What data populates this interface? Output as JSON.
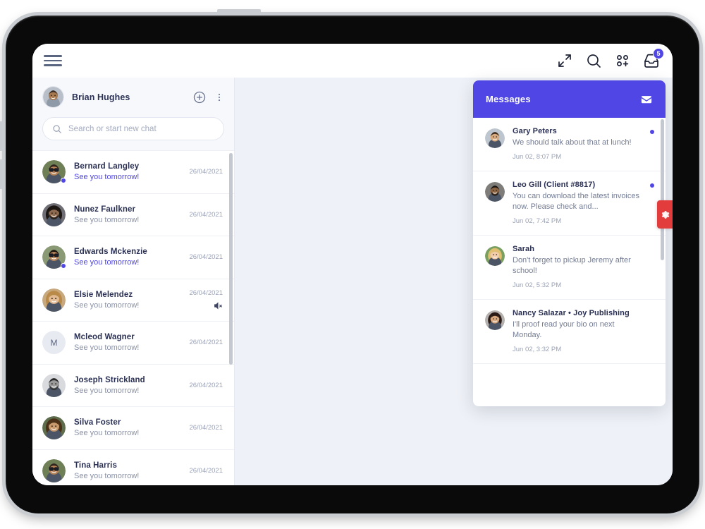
{
  "topbar": {
    "menu_icon": "hamburger-icon",
    "actions": [
      {
        "icon": "fullscreen-expand-icon",
        "label": "Fullscreen"
      },
      {
        "icon": "search-icon",
        "label": "Search"
      },
      {
        "icon": "apps-add-icon",
        "label": "Add app"
      },
      {
        "icon": "inbox-icon",
        "label": "Inbox",
        "badge": "5"
      }
    ]
  },
  "sidebar": {
    "profile": {
      "name": "Brian Hughes",
      "avatar": "avatar-brian"
    },
    "add_chat_icon": "plus-circle-icon",
    "more_icon": "more-vertical-icon",
    "search": {
      "placeholder": "Search or start new chat",
      "value": "",
      "icon": "search-icon"
    },
    "chats": [
      {
        "name": "Bernard Langley",
        "preview": "See you tomorrow!",
        "date": "26/04/2021",
        "unread": true,
        "online": true,
        "muted": false,
        "initial": ""
      },
      {
        "name": "Nunez Faulkner",
        "preview": "See you tomorrow!",
        "date": "26/04/2021",
        "unread": false,
        "online": false,
        "muted": false,
        "initial": ""
      },
      {
        "name": "Edwards Mckenzie",
        "preview": "See you tomorrow!",
        "date": "26/04/2021",
        "unread": true,
        "online": true,
        "muted": false,
        "initial": ""
      },
      {
        "name": "Elsie Melendez",
        "preview": "See you tomorrow!",
        "date": "26/04/2021",
        "unread": false,
        "online": false,
        "muted": true,
        "initial": ""
      },
      {
        "name": "Mcleod Wagner",
        "preview": "See you tomorrow!",
        "date": "26/04/2021",
        "unread": false,
        "online": false,
        "muted": false,
        "initial": "M"
      },
      {
        "name": "Joseph Strickland",
        "preview": "See you tomorrow!",
        "date": "26/04/2021",
        "unread": false,
        "online": false,
        "muted": false,
        "initial": ""
      },
      {
        "name": "Silva Foster",
        "preview": "See you tomorrow!",
        "date": "26/04/2021",
        "unread": false,
        "online": false,
        "muted": false,
        "initial": ""
      },
      {
        "name": "Tina Harris",
        "preview": "See you tomorrow!",
        "date": "26/04/2021",
        "unread": false,
        "online": false,
        "muted": false,
        "initial": ""
      }
    ]
  },
  "messages_panel": {
    "title": "Messages",
    "header_icon": "envelope-icon",
    "items": [
      {
        "sender": "Gary Peters",
        "text": "We should talk about that at lunch!",
        "time": "Jun 02, 8:07 PM",
        "unread": true
      },
      {
        "sender": "Leo Gill (Client #8817)",
        "text": "You can download the latest invoices now. Please check and...",
        "time": "Jun 02, 7:42 PM",
        "unread": true
      },
      {
        "sender": "Sarah",
        "text": "Don't forget to pickup Jeremy after school!",
        "time": "Jun 02, 5:32 PM",
        "unread": false
      },
      {
        "sender": "Nancy Salazar • Joy Publishing",
        "text": "I'll proof read your bio on next Monday.",
        "time": "Jun 02, 3:32 PM",
        "unread": false
      }
    ]
  },
  "settings_tab": {
    "icon": "gear-icon",
    "label": "Settings"
  },
  "colors": {
    "accent": "#4f46e5",
    "settings_tab": "#e23c3c",
    "page_background": "#eef1f7",
    "panel_background": "#ffffff",
    "sidebar_header": "#f7f8fb",
    "text_primary": "#2b3154",
    "text_muted": "#8a92a8"
  }
}
